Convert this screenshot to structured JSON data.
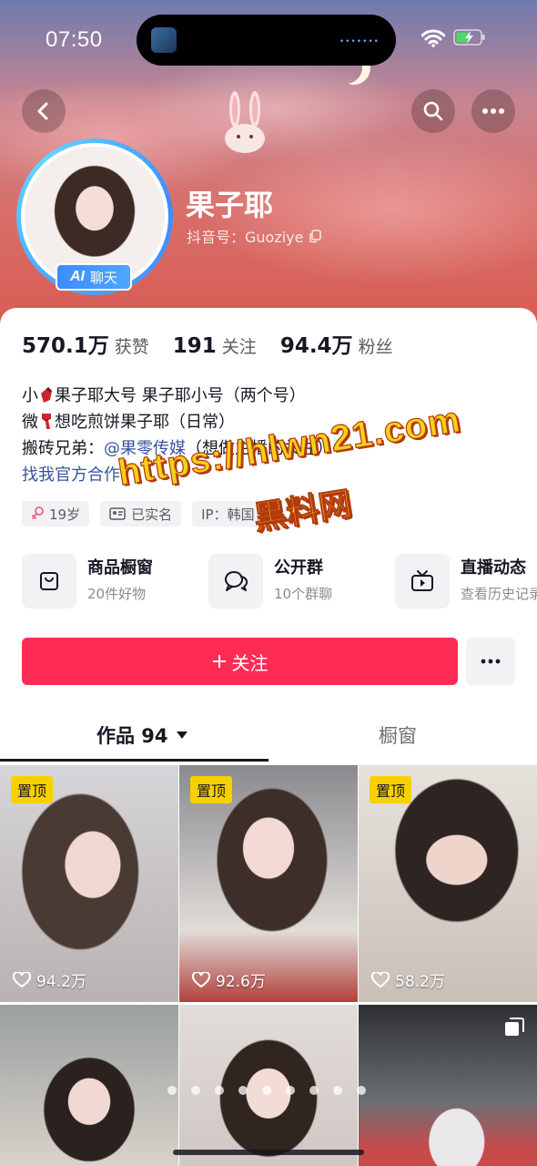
{
  "status_bar": {
    "time": "07:50"
  },
  "profile": {
    "nickname": "果子耶",
    "douyin_id": "抖音号：Guoziye",
    "ai_badge_ai": "AI",
    "ai_badge_text": "聊天"
  },
  "stats": [
    {
      "num": "570.1万",
      "label": "获赞"
    },
    {
      "num": "191",
      "label": "关注"
    },
    {
      "num": "94.4万",
      "label": "粉丝"
    }
  ],
  "bio": {
    "line1_a": "小",
    "line1_b": "果子耶大号 果子耶小号（两个号）",
    "line2_a": "微",
    "line2_b": "想吃煎饼果子耶（日常）",
    "line3_a": "搬砖兄弟：",
    "line3_mention": "@果零传媒",
    "line3_b": "（想做主播的关注）",
    "link": "找我官方合作"
  },
  "tags": [
    {
      "text": "19岁"
    },
    {
      "text": "已实名"
    },
    {
      "text": "IP：韩国"
    }
  ],
  "watermark": {
    "url": "https://hlwn21.com",
    "name": "黑料网"
  },
  "entries": [
    {
      "title": "商品橱窗",
      "sub": "20件好物"
    },
    {
      "title": "公开群",
      "sub": "10个群聊"
    },
    {
      "title": "直播动态",
      "sub": "查看历史记录"
    }
  ],
  "follow_label": "关注",
  "tabs": {
    "works": "作品 94",
    "shop": "橱窗"
  },
  "grid": [
    {
      "pin": "置顶",
      "likes": "94.2万"
    },
    {
      "pin": "置顶",
      "likes": "92.6万"
    },
    {
      "pin": "置顶",
      "likes": "58.2万"
    },
    {
      "pin": "",
      "likes": ""
    },
    {
      "pin": "",
      "likes": ""
    },
    {
      "pin": "",
      "likes": ""
    }
  ],
  "colors": {
    "accent": "#fe2c55",
    "pin": "#f8d000",
    "mention": "#35539c",
    "avatar_ring": "#4aa3ff"
  }
}
